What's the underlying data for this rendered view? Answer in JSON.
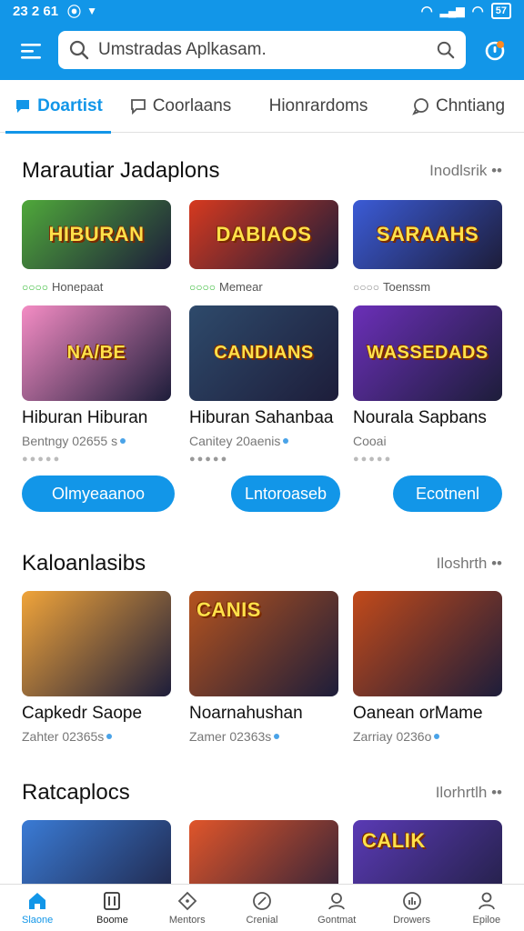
{
  "status": {
    "time": "23 2 61",
    "battery": "57"
  },
  "search": {
    "value": "Umstradas Aplkasam."
  },
  "tabs": [
    {
      "label": "Doartist"
    },
    {
      "label": "Coorlaans"
    },
    {
      "label": "Hionrardoms"
    },
    {
      "label": "Chntiang"
    }
  ],
  "section1": {
    "title": "Marautiar Jadaplons",
    "more": "Inodlsrik ••",
    "row1": [
      {
        "art": "HIBURAN",
        "sub": "Honepaat",
        "bg": "#4fa83a"
      },
      {
        "art": "DABIAOS",
        "sub": "Memear",
        "bg": "#d6391f"
      },
      {
        "art": "SARAAHS",
        "sub": "Toenssm",
        "bg": "#3b5bd6"
      }
    ],
    "row2": [
      {
        "art": "NA/BE",
        "name": "Hiburan Hiburan",
        "meta": "Bentngy 02655 s",
        "bg": "#f48cc4"
      },
      {
        "art": "CANDIANS",
        "name": "Hiburan Sahanbaa",
        "meta": "Canitey 20aenis",
        "bg": "#2e4a6b"
      },
      {
        "art": "WASSEDADS",
        "name": "Nourala Sapbans",
        "meta": "Cooai",
        "bg": "#6b2fb8"
      }
    ],
    "buttons": [
      "Olmyeaanoo",
      "Lntoroaseb",
      "Ecotnenl"
    ]
  },
  "section2": {
    "title": "Kaloanlasibs",
    "more": "Iloshrth ••",
    "cards": [
      {
        "name": "Capkedr Saope",
        "meta": "Zahter 02365s",
        "bg": "#f0a43a"
      },
      {
        "art": "CANIS",
        "name": "Noarnahushan",
        "meta": "Zamer 02363s",
        "bg": "#b5531e"
      },
      {
        "name": "Oanean orMame",
        "meta": "Zarriay 0236o",
        "bg": "#c24a1a"
      }
    ]
  },
  "section3": {
    "title": "Ratcaplocs",
    "more": "Ilorhrtlh ••",
    "cards": [
      {
        "bg": "#3a7bd5"
      },
      {
        "bg": "#e0552a"
      },
      {
        "art": "CALIK",
        "bg": "#5a3ab5"
      }
    ]
  },
  "nav": [
    {
      "label": "Slaone",
      "icon": "home-icon"
    },
    {
      "label": "Boome",
      "icon": "book-icon"
    },
    {
      "label": "Mentors",
      "icon": "tag-icon"
    },
    {
      "label": "Crenial",
      "icon": "compass-icon"
    },
    {
      "label": "Gontmat",
      "icon": "user-icon"
    },
    {
      "label": "Drowers",
      "icon": "chart-icon"
    },
    {
      "label": "Epiloe",
      "icon": "profile-icon"
    }
  ]
}
